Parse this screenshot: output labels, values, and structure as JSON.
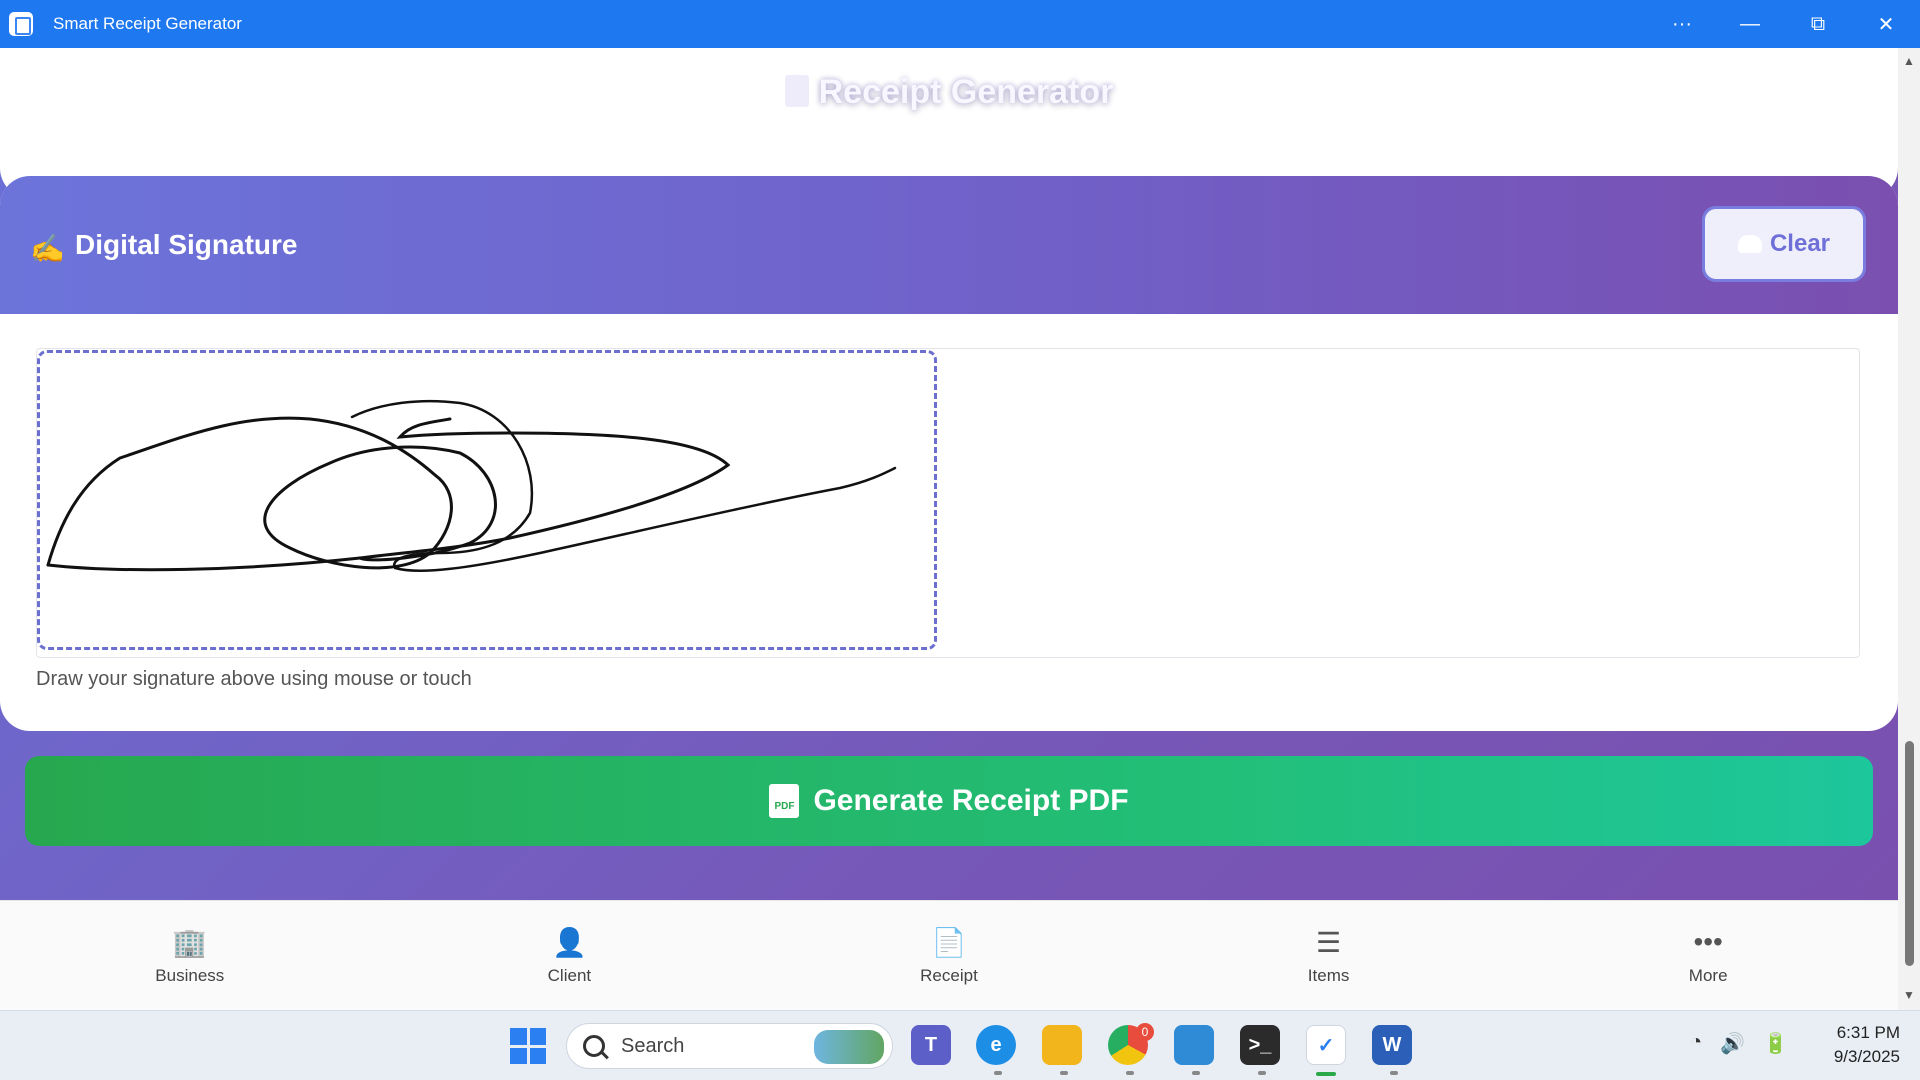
{
  "window": {
    "title": "Smart Receipt Generator",
    "more_label": "···",
    "minimize_label": "—",
    "restore_label": "⧉",
    "close_label": "✕"
  },
  "header": {
    "title": "Receipt Generator"
  },
  "signature": {
    "title": "Digital Signature",
    "clear_label": "Clear",
    "help_text": "Draw your signature above using mouse or touch"
  },
  "actions": {
    "generate_label": "Generate Receipt PDF"
  },
  "bottom_nav": {
    "items": [
      {
        "label": "Business",
        "icon": "building-icon"
      },
      {
        "label": "Client",
        "icon": "user-icon"
      },
      {
        "label": "Receipt",
        "icon": "receipt-icon"
      },
      {
        "label": "Items",
        "icon": "list-icon"
      },
      {
        "label": "More",
        "icon": "more-icon"
      }
    ]
  },
  "taskbar": {
    "search_placeholder": "Search",
    "chrome_badge": "0",
    "time": "6:31 PM",
    "date": "9/3/2025"
  },
  "colors": {
    "titlebar": "#1e78f0",
    "accent": "#6b6fce",
    "generate_button": "#27a84f"
  }
}
